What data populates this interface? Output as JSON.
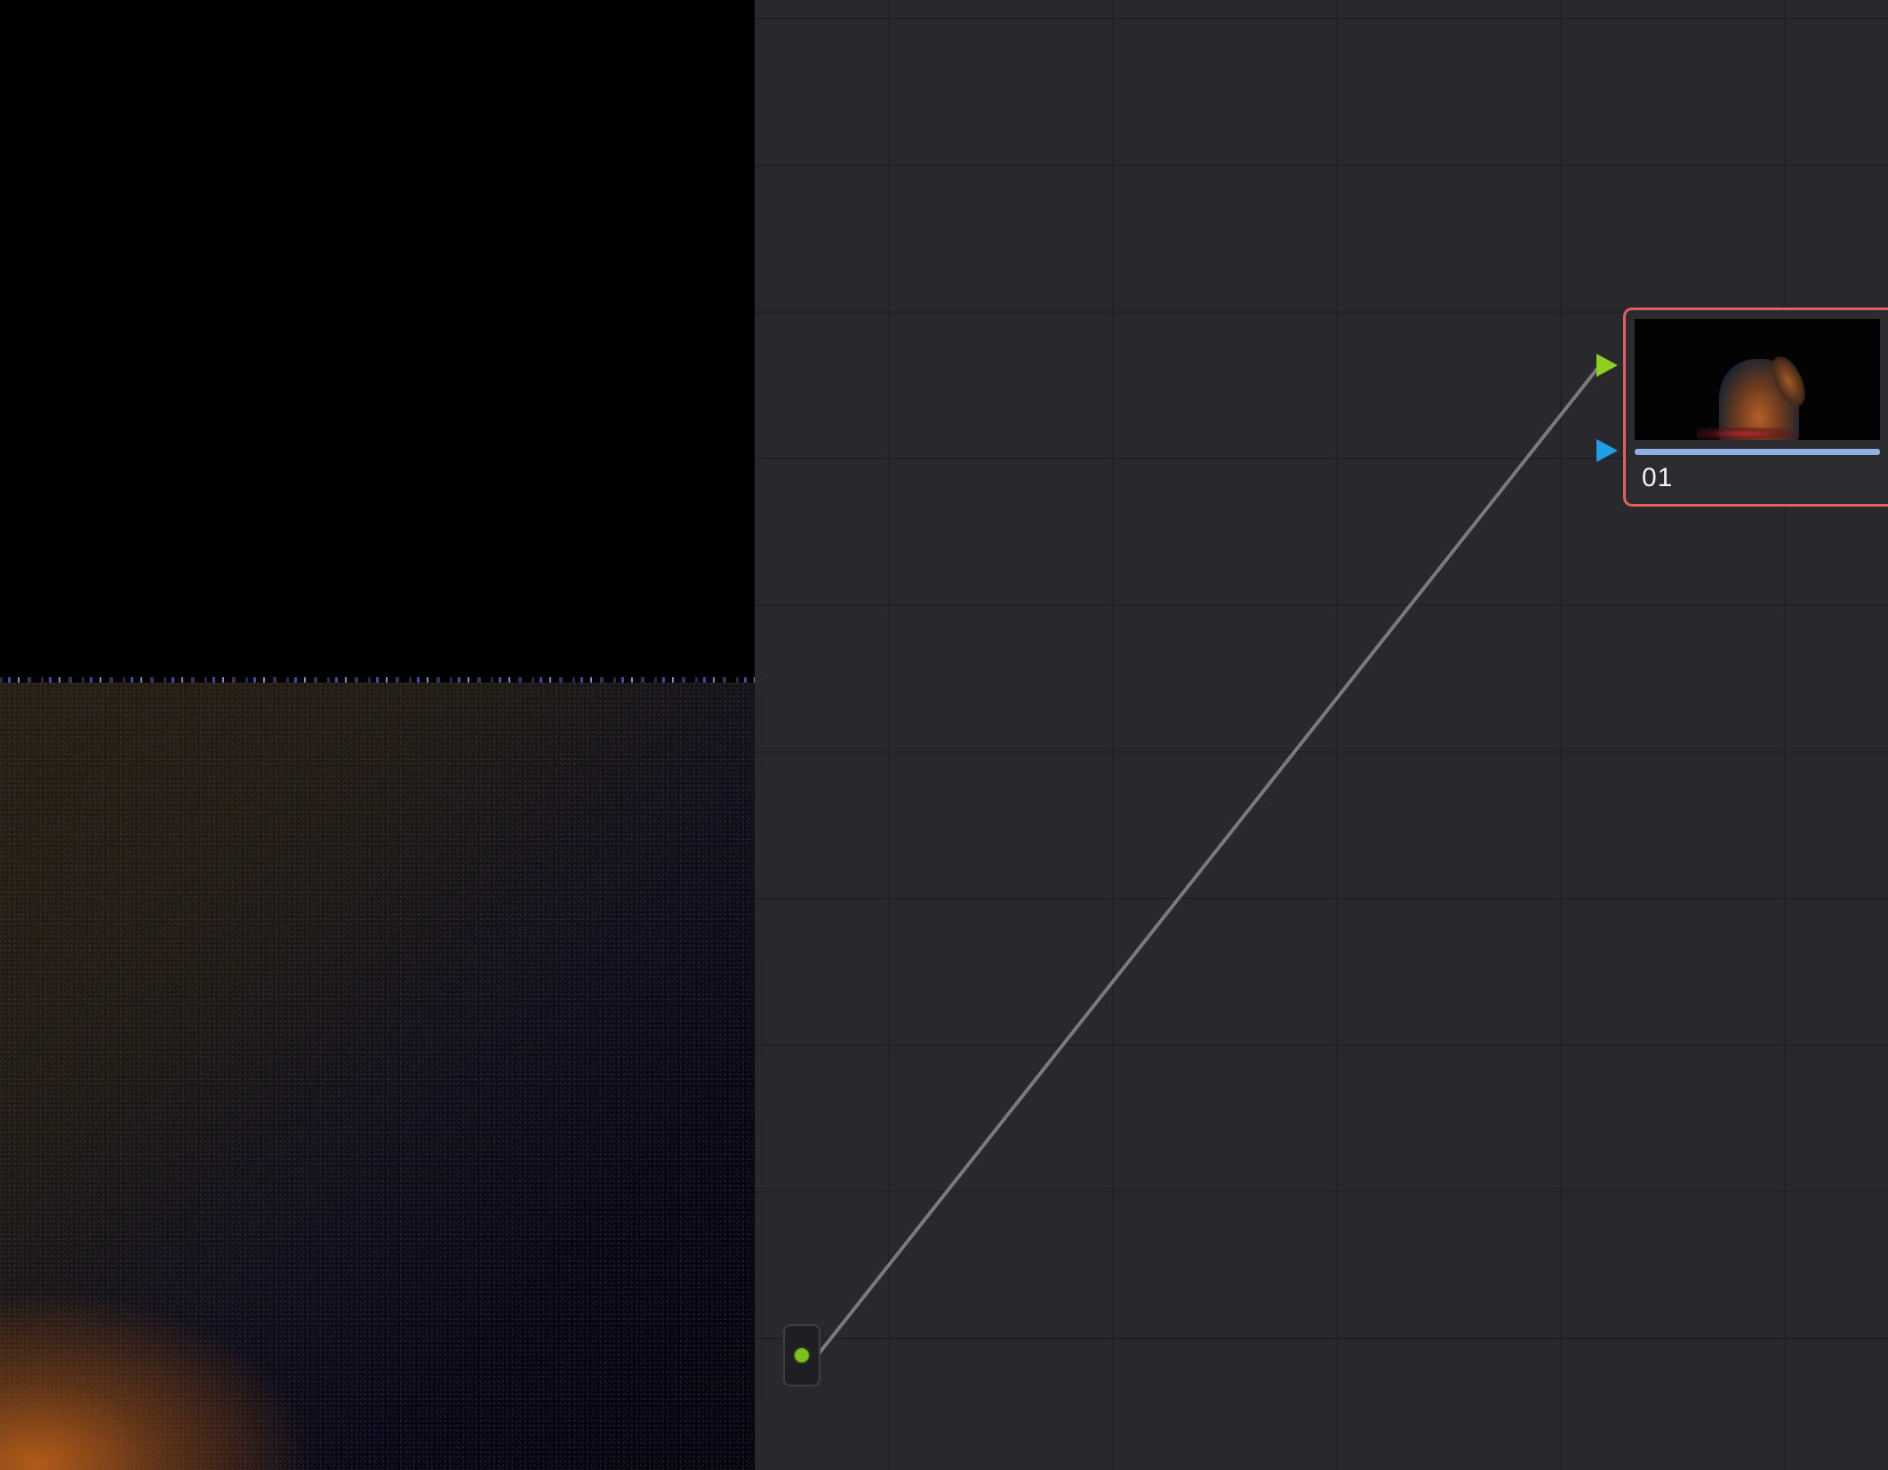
{
  "viewer": {
    "description_icon": "viewer-image"
  },
  "node_graph": {
    "nodes": [
      {
        "label": "01",
        "status_color": "#e06060",
        "inputs": [
          {
            "type": "rgb",
            "color": "#8ed01e",
            "icon": "triangle-right-icon"
          },
          {
            "type": "key",
            "color": "#1e9fe8",
            "icon": "triangle-right-icon"
          }
        ],
        "thumbnail_icon": "node-thumbnail"
      }
    ],
    "source": {
      "color": "#7fbf1d",
      "icon": "source-dot-icon"
    },
    "connection": {
      "color": "#7a7a80"
    },
    "colors": {
      "background": "#28282d",
      "grid": "#222226"
    }
  }
}
